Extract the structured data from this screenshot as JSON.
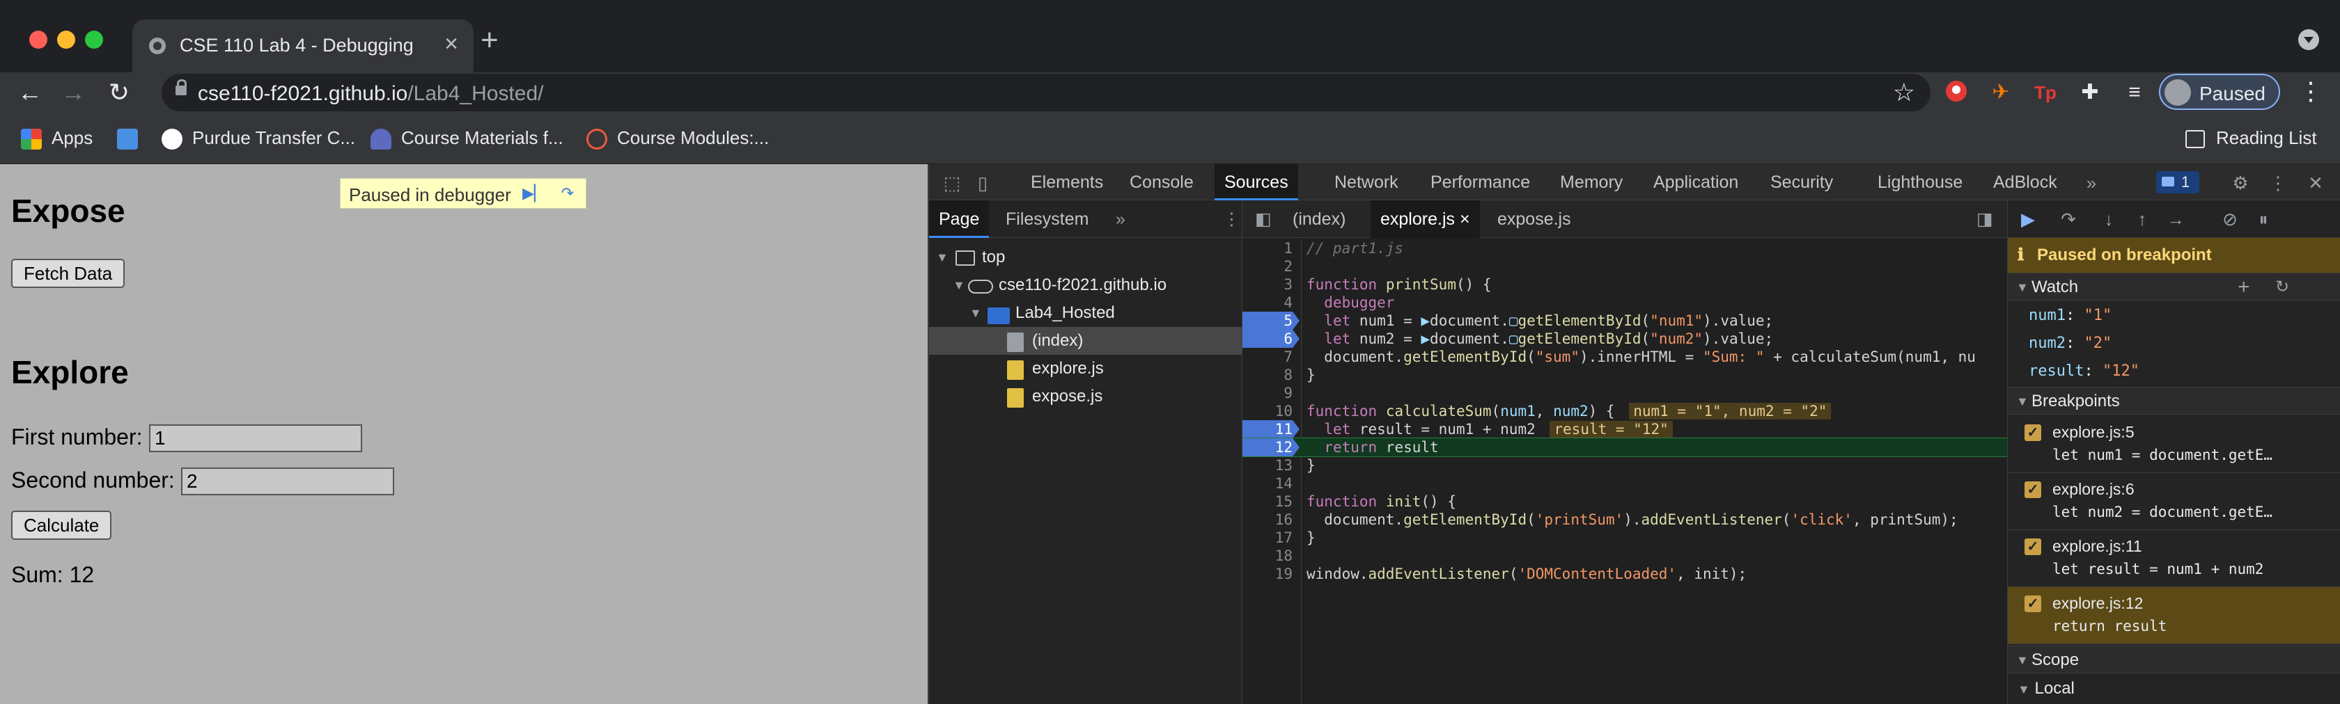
{
  "browser": {
    "tab_title": "CSE 110 Lab 4 - Debugging",
    "url_host": "cse110-f2021.github.io",
    "url_path": "/Lab4_Hosted/",
    "profile_label": "Paused",
    "bookmarks": [
      {
        "label": "Apps",
        "icon": "apps-grid-icon"
      },
      {
        "label": "",
        "icon": "bookmark-favicon"
      },
      {
        "label": "Purdue Transfer C...",
        "icon": "globe-icon"
      },
      {
        "label": "Course Materials f...",
        "icon": "course-icon"
      },
      {
        "label": "Course Modules:...",
        "icon": "modules-icon"
      }
    ],
    "reading_list": "Reading List"
  },
  "page": {
    "paused_banner": "Paused in debugger",
    "heading_expose": "Expose",
    "fetch_button": "Fetch Data",
    "heading_explore": "Explore",
    "first_label": "First number:",
    "first_value": "1",
    "second_label": "Second number:",
    "second_value": "2",
    "calculate_button": "Calculate",
    "sum_text": "Sum: 12"
  },
  "devtools": {
    "tabs": [
      "Elements",
      "Console",
      "Sources",
      "Network",
      "Performance",
      "Memory",
      "Application",
      "Security",
      "Lighthouse",
      "AdBlock"
    ],
    "active_tab": "Sources",
    "messages_count": "1",
    "navigator": {
      "tabs": [
        "Page",
        "Filesystem"
      ],
      "tree": {
        "top": "top",
        "domain": "cse110-f2021.github.io",
        "folder": "Lab4_Hosted",
        "files": [
          "(index)",
          "explore.js",
          "expose.js"
        ]
      }
    },
    "editor": {
      "tabs": [
        "(index)",
        "explore.js",
        "expose.js"
      ],
      "active_tab": "explore.js"
    },
    "debugger": {
      "paused_message": "Paused on breakpoint",
      "watch_title": "Watch",
      "watch": [
        {
          "name": "num1",
          "value": "\"1\""
        },
        {
          "name": "num2",
          "value": "\"2\""
        },
        {
          "name": "result",
          "value": "\"12\""
        }
      ],
      "breakpoints_title": "Breakpoints",
      "breakpoints": [
        {
          "location": "explore.js:5",
          "code": "let num1 = document.getE…"
        },
        {
          "location": "explore.js:6",
          "code": "let num2 = document.getE…"
        },
        {
          "location": "explore.js:11",
          "code": "let result = num1 + num2"
        },
        {
          "location": "explore.js:12",
          "code": "return result"
        }
      ],
      "scope_title": "Scope",
      "local_title": "Local"
    }
  }
}
